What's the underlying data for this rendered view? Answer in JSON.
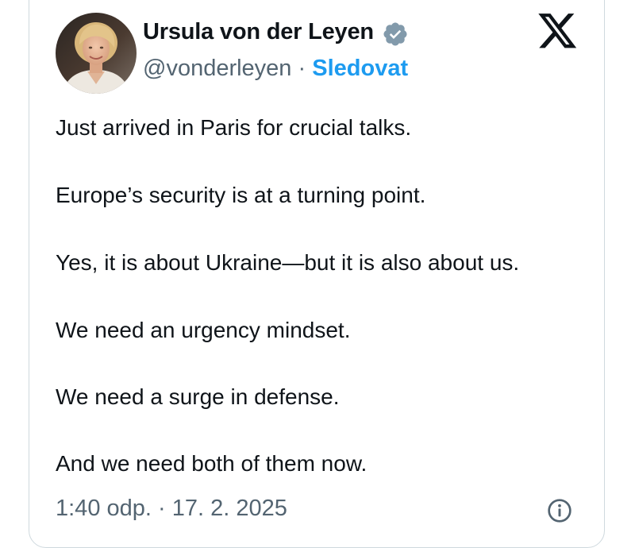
{
  "author": {
    "name": "Ursula von der Leyen",
    "handle": "@vonderleyen",
    "separator": " · ",
    "follow_label": "Sledovat",
    "verified_badge_color": "#829aab"
  },
  "brand": {
    "logo_icon": "x-logo-icon",
    "link_color": "#1d9bf0"
  },
  "tweet": {
    "lines": [
      "Just arrived in Paris for crucial talks.",
      "Europe’s security is at a turning point.",
      "Yes, it is about Ukraine—but it is also about us.",
      "We need an urgency mindset.",
      "We need a surge in defense.",
      "And we need both of them now."
    ]
  },
  "meta": {
    "time": "1:40 odp.",
    "separator": " · ",
    "date": "17. 2. 2025",
    "info_icon": "info-icon"
  }
}
